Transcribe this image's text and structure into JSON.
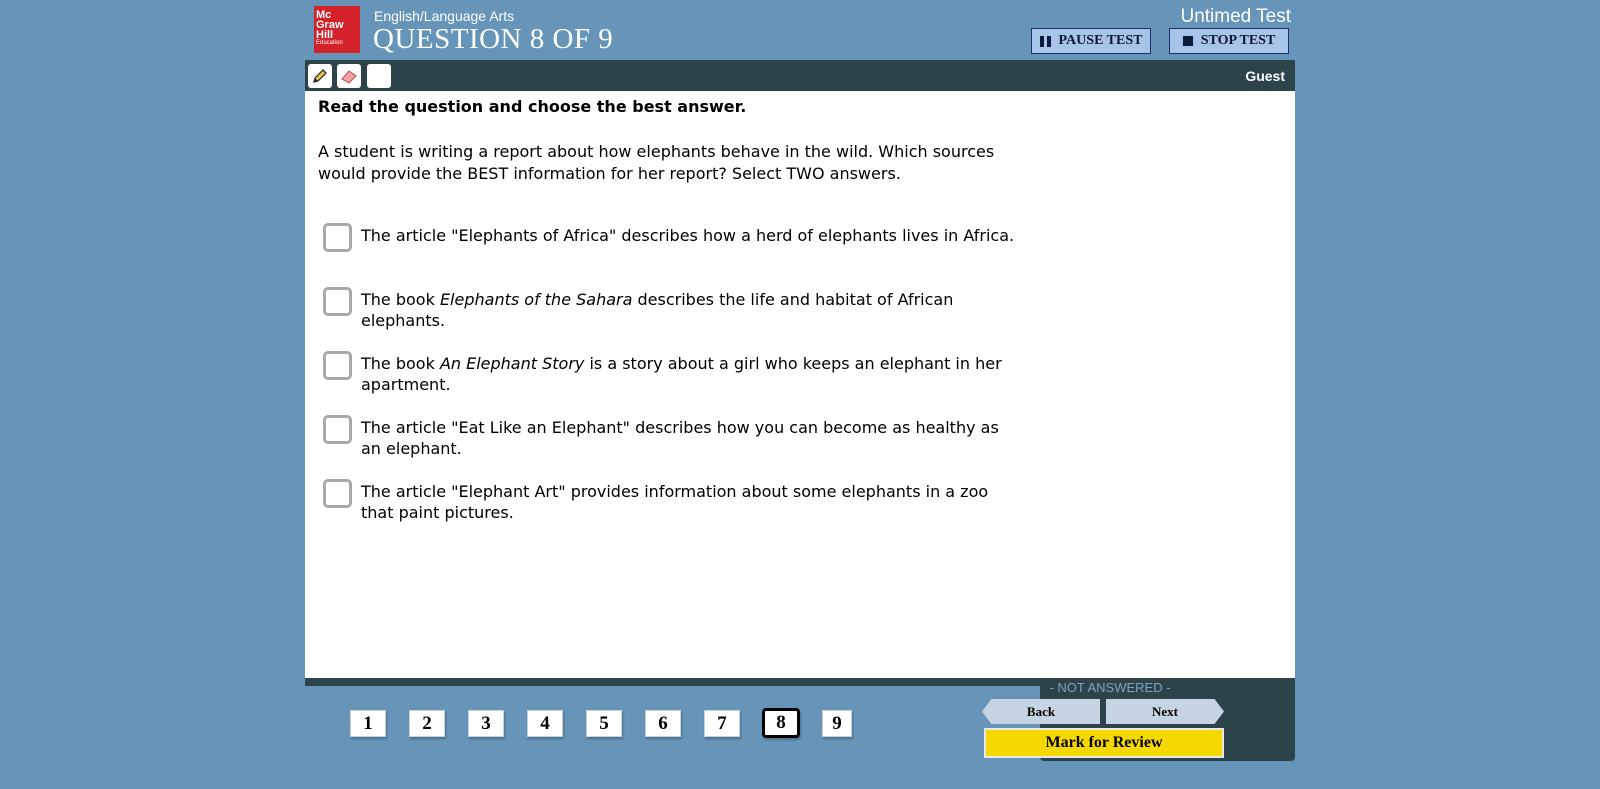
{
  "header": {
    "logo_lines": [
      "Mc",
      "Graw",
      "Hill",
      "Education"
    ],
    "subject": "English/Language Arts",
    "question_title": "QUESTION 8 OF 9",
    "test_mode": "Untimed Test",
    "pause_label": "PAUSE TEST",
    "stop_label": "STOP TEST"
  },
  "toolbar": {
    "tools": [
      "pencil-icon",
      "eraser-icon",
      "blank-tool"
    ],
    "user": "Guest"
  },
  "question": {
    "instruction": "Read the question and choose the best answer.",
    "stem": "A student is writing a report about how elephants behave in the wild. Which sources would provide the BEST information for her report? Select TWO answers.",
    "choices": [
      {
        "pre": "The article \"Elephants of Africa\" describes how a herd of elephants lives in Africa.",
        "em": "",
        "post": "",
        "checked": false
      },
      {
        "pre": "The book ",
        "em": "Elephants of the Sahara",
        "post": " describes the life and habitat of African elephants.",
        "checked": false
      },
      {
        "pre": "The book ",
        "em": "An Elephant Story",
        "post": " is a story about a girl who keeps an elephant in her apartment.",
        "checked": false
      },
      {
        "pre": "The article \"Eat Like an Elephant\" describes how you can become as healthy as an elephant.",
        "em": "",
        "post": "",
        "checked": false
      },
      {
        "pre": "The article \"Elephant Art\" provides information about some elephants in a zoo that paint pictures.",
        "em": "",
        "post": "",
        "checked": false
      }
    ]
  },
  "footer": {
    "question_numbers": [
      "1",
      "2",
      "3",
      "4",
      "5",
      "6",
      "7",
      "8",
      "9"
    ],
    "current_question": "8",
    "status": "- NOT ANSWERED -",
    "back_label": "Back",
    "next_label": "Next",
    "review_label": "Mark for Review"
  },
  "colors": {
    "background": "#6695b9",
    "toolbar": "#2d434a",
    "review_button": "#f5d800",
    "logo": "#d3222a"
  }
}
